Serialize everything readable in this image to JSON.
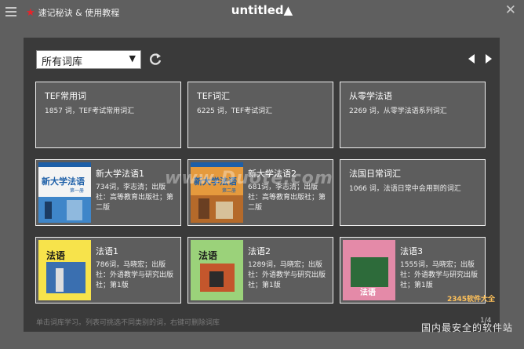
{
  "topbar": {
    "tips_label": "速记秘诀 & 使用教程",
    "app_title": "untitled▲"
  },
  "toolbar": {
    "library_select": "所有词库"
  },
  "cards": [
    {
      "title": "TEF常用词",
      "desc": "1857 词，TEF考试常用词汇"
    },
    {
      "title": "TEF词汇",
      "desc": "6225 词，TEF考试词汇"
    },
    {
      "title": "从零学法语",
      "desc": "2269 词，从零学法语系列词汇"
    },
    {
      "title": "新大学法语1",
      "desc": "734词，李志清；出版社：高等教育出版社；第二版",
      "cover_text": "新大学法语",
      "cover_sub": "第一册"
    },
    {
      "title": "新大学法语2",
      "desc": "681词，李志清；出版社：高等教育出版社；第二版",
      "cover_text": "新大学法语",
      "cover_sub": "第二册"
    },
    {
      "title": "法国日常词汇",
      "desc": "1066 词，法语日常中会用到的词汇"
    },
    {
      "title": "法语1",
      "desc": "786词，马晓宏；出版社：外语教学与研究出版社；第1版",
      "cover_text": "法语"
    },
    {
      "title": "法语2",
      "desc": "1289词，马晓宏；出版社：外语教学与研究出版社；第1版",
      "cover_text": "法语"
    },
    {
      "title": "法语3",
      "desc": "1555词，马晓宏；出版社：外语教学与研究出版社；第1版",
      "cover_text": "法语"
    }
  ],
  "footer": {
    "hint": "单击词库学习。列表可挑选不同类别的词，右键可删除词库",
    "page": "1/4"
  },
  "watermarks": {
    "site": "www.Duote.com",
    "brand": "2345软件大全",
    "slogan": "国内最安全的软件站"
  },
  "colors": {
    "background": "#5f5f5f",
    "panel": "#3a3a3a",
    "card": "#5d5d5d",
    "star": "#e8232a"
  }
}
